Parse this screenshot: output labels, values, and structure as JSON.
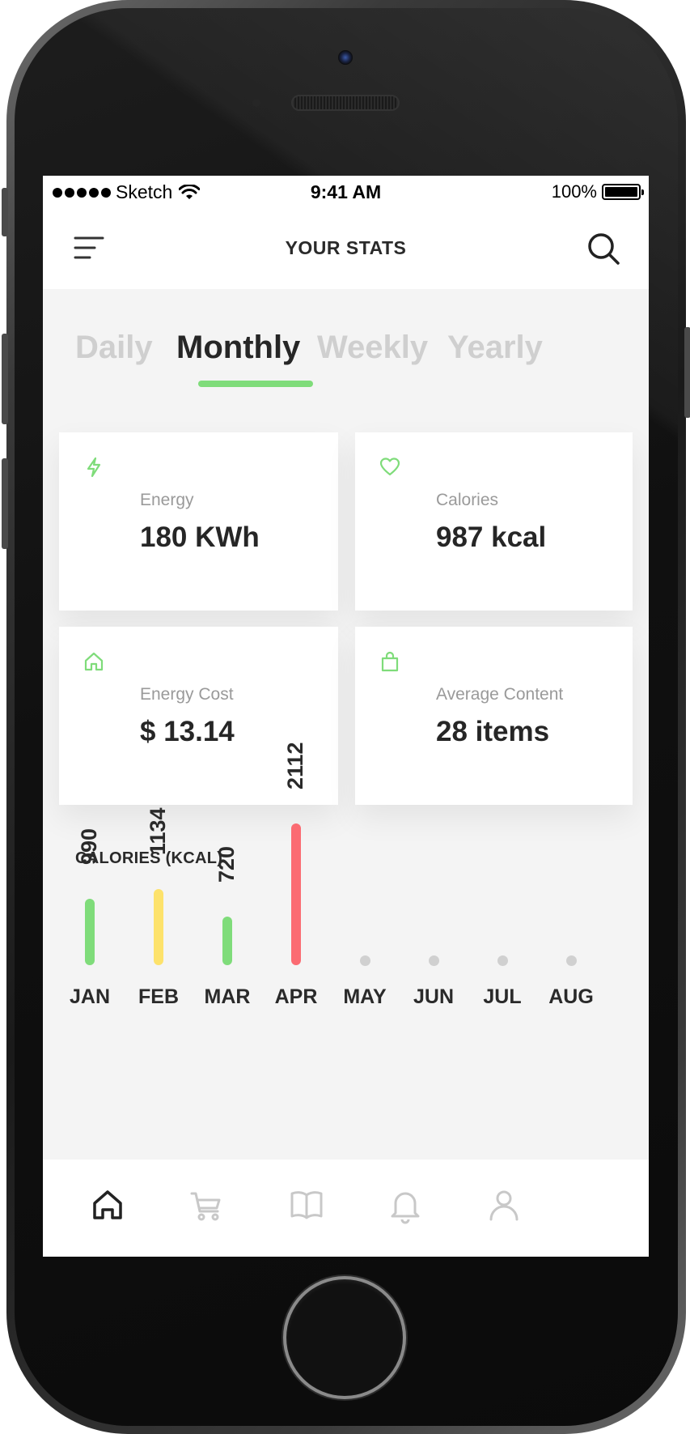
{
  "status_bar": {
    "carrier": "Sketch",
    "time": "9:41 AM",
    "battery": "100%"
  },
  "header": {
    "title": "YOUR STATS",
    "menu_icon": "hamburger-menu-icon",
    "search_icon": "search-icon"
  },
  "tabs": [
    {
      "label": "Daily",
      "active": false
    },
    {
      "label": "Monthly",
      "active": true
    },
    {
      "label": "Weekly",
      "active": false
    },
    {
      "label": "Yearly",
      "active": false
    }
  ],
  "cards": [
    {
      "icon": "lightning-icon",
      "label": "Energy",
      "value": "180 KWh"
    },
    {
      "icon": "heart-icon",
      "label": "Calories",
      "value": "987 kcal"
    },
    {
      "icon": "home-icon",
      "label": "Energy Cost",
      "value": "$ 13.14"
    },
    {
      "icon": "shopping-bag-icon",
      "label": "Average Content",
      "value": "28 items"
    }
  ],
  "chart": {
    "title": "CALORIES (KCAL)"
  },
  "chart_data": {
    "type": "bar",
    "title": "CALORIES (KCAL)",
    "categories": [
      "JAN",
      "FEB",
      "MAR",
      "APR",
      "MAY",
      "JUN",
      "JUL",
      "AUG"
    ],
    "values": [
      990,
      1134,
      720,
      2112,
      null,
      null,
      null,
      null
    ],
    "colors": [
      "#7fdc7a",
      "#fde26b",
      "#7fdc7a",
      "#fb6b72",
      null,
      null,
      null,
      null
    ],
    "ylim": [
      0,
      2112
    ],
    "grid": false
  },
  "bottom_nav": [
    {
      "icon": "home-icon",
      "active": true
    },
    {
      "icon": "cart-icon",
      "active": false
    },
    {
      "icon": "book-icon",
      "active": false
    },
    {
      "icon": "bell-icon",
      "active": false
    },
    {
      "icon": "user-icon",
      "active": false
    }
  ],
  "colors": {
    "accent_green": "#7fdc7a",
    "bar_yellow": "#fde26b",
    "bar_red": "#fb6b72",
    "inactive_gray": "#cfcfcf",
    "text_dark": "#262626"
  }
}
